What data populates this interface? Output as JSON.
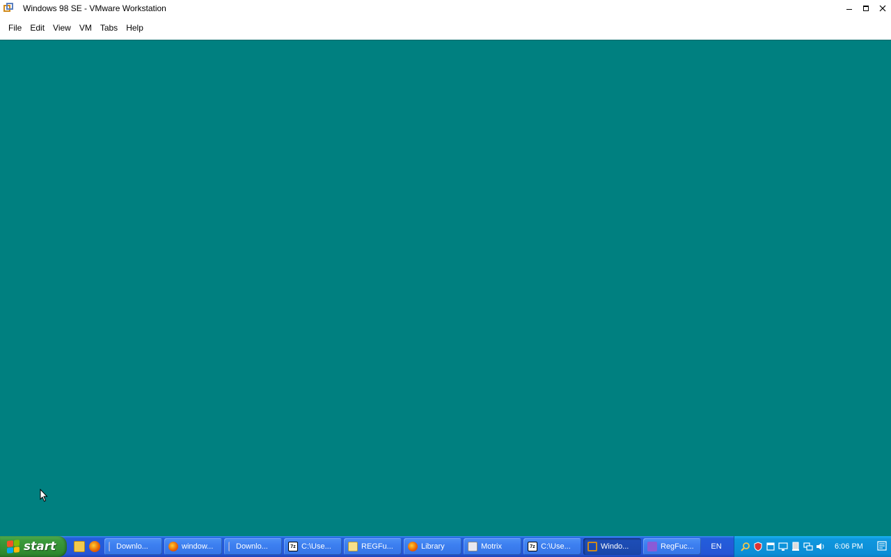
{
  "window": {
    "title": "Windows 98 SE - VMware Workstation"
  },
  "menu": [
    "File",
    "Edit",
    "View",
    "VM",
    "Tabs",
    "Help"
  ],
  "vm": {
    "desktop_color": "#008080"
  },
  "taskbar": {
    "start_label": "start",
    "quick_launch": [
      "folder-icon",
      "firefox-icon"
    ],
    "tasks": [
      {
        "label": "Downlo...",
        "icon": "download-icon",
        "active": false
      },
      {
        "label": "window...",
        "icon": "firefox-icon",
        "active": false
      },
      {
        "label": "Downlo...",
        "icon": "download-icon",
        "active": false
      },
      {
        "label": "C:\\Use...",
        "icon": "7zip-icon",
        "active": false
      },
      {
        "label": "REGFu...",
        "icon": "notepad-icon",
        "active": false
      },
      {
        "label": "Library",
        "icon": "firefox-icon",
        "active": false
      },
      {
        "label": "Motrix",
        "icon": "motrix-icon",
        "active": false
      },
      {
        "label": "C:\\Use...",
        "icon": "7zip-icon",
        "active": false
      },
      {
        "label": "Windo...",
        "icon": "vmware-icon",
        "active": true
      },
      {
        "label": "RegFuc...",
        "icon": "visual-studio-icon",
        "active": false
      }
    ],
    "language": "EN",
    "tray_icons": [
      "search-icon",
      "shield-icon",
      "window-icon",
      "display-icon",
      "safely-remove-icon",
      "network-icon",
      "volume-icon"
    ],
    "clock": "6:06 PM",
    "seven_zip_glyph": "7z"
  }
}
